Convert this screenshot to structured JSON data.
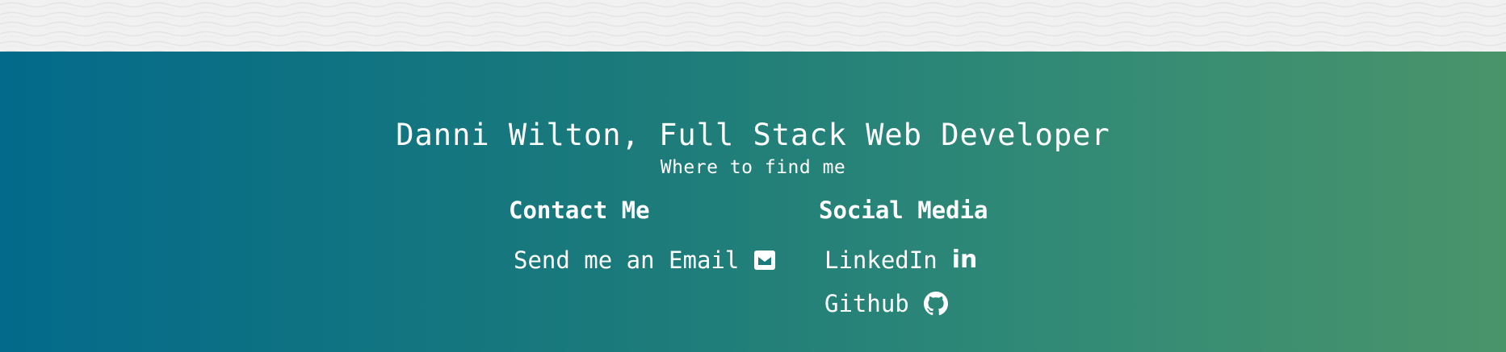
{
  "colors": {
    "gradient_start": "#036a8b",
    "gradient_end": "#4a946a",
    "texture_background": "#f1f1f1",
    "text": "#ffffff"
  },
  "footer": {
    "title": "Danni Wilton, Full Stack Web Developer",
    "subtitle": "Where to find me",
    "contact": {
      "heading": "Contact Me",
      "email_label": "Send me an Email",
      "email_icon": "envelope-icon"
    },
    "social": {
      "heading": "Social Media",
      "linkedin_label": "LinkedIn",
      "linkedin_icon": "linkedin-icon",
      "linkedin_glyph": "in",
      "github_label": "Github",
      "github_icon": "github-icon"
    }
  }
}
